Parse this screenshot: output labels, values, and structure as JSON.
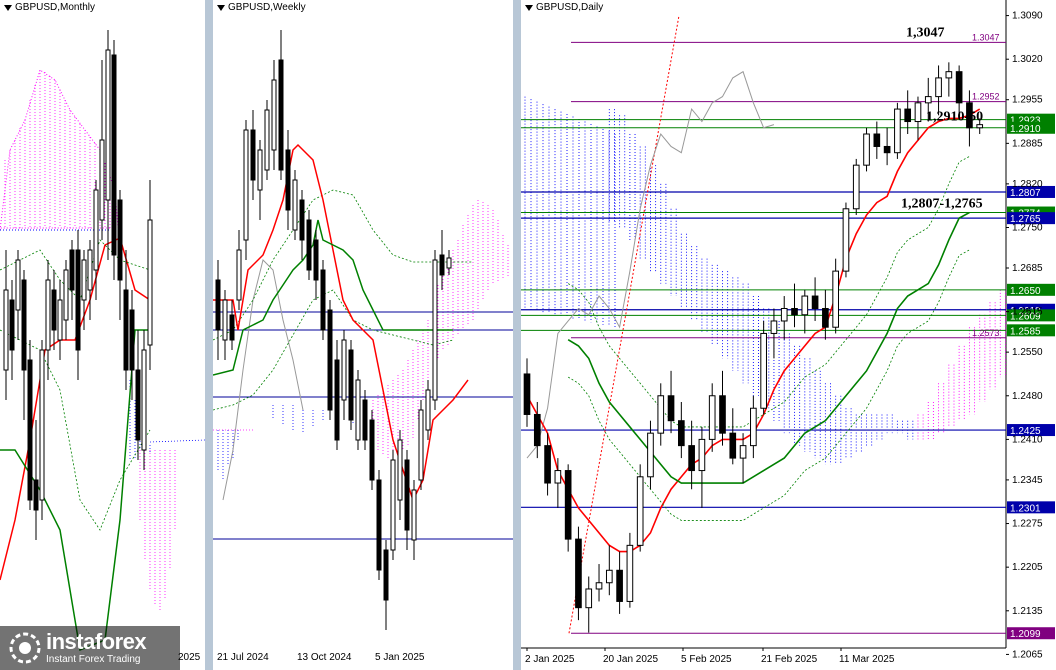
{
  "panels": {
    "monthly": {
      "title": "GBPUSD,Monthly",
      "date_labels": [
        "2025"
      ]
    },
    "weekly": {
      "title": "GBPUSD,Weekly",
      "date_labels": [
        "21 Jul 2024",
        "13 Oct 2024",
        "5 Jan 2025"
      ]
    },
    "daily": {
      "title": "GBPUSD,Daily",
      "date_labels": [
        "2 Jan 2025",
        "20 Jan 2025",
        "5 Feb 2025",
        "21 Feb 2025",
        "11 Mar 2025"
      ]
    }
  },
  "watermark": {
    "name": "instaforex",
    "tagline": "Instant Forex Trading"
  },
  "colors": {
    "up": "#000000",
    "down": "#000000",
    "tenkan": "#ff0000",
    "kijun": "#008000",
    "cloud_bull": "#ff00ff",
    "cloud_bear": "#0000ff",
    "level_blue": "#000099",
    "level_green": "#008000",
    "level_purple": "#800080",
    "tag_green": "#008000",
    "tag_blue": "#0000aa"
  },
  "chart_data": {
    "type": "candlestick",
    "title": "GBPUSD,Daily",
    "price_axis": [
      "1.3090",
      "1.3020",
      "1.2955",
      "1.2885",
      "1.2820",
      "1.2750",
      "1.2685",
      "1.2615",
      "1.2550",
      "1.2480",
      "1.2410",
      "1.2345",
      "1.2275",
      "1.2205",
      "1.2135",
      "1.2065"
    ],
    "ylim": [
      1.204,
      1.3115
    ],
    "x_labels": [
      "2 Jan 2025",
      "20 Jan 2025",
      "5 Feb 2025",
      "21 Feb 2025",
      "11 Mar 2025"
    ],
    "annotations": [
      {
        "text": "1,3047",
        "value": 1.3047
      },
      {
        "text": "1,2910-50",
        "value": 1.293
      },
      {
        "text": "1,2807-1,2765",
        "value": 1.279
      }
    ],
    "levels": [
      {
        "value": 1.3047,
        "label": "1.3047",
        "color": "#800080",
        "tag": false
      },
      {
        "value": 1.2952,
        "label": "1.2952",
        "color": "#800080",
        "tag": false
      },
      {
        "value": 1.2923,
        "label": "1.2923",
        "color": "#008000",
        "tag": true
      },
      {
        "value": 1.291,
        "label": "1.2910",
        "color": "#008000",
        "tag": true
      },
      {
        "value": 1.2807,
        "label": "1.2807",
        "color": "#0000aa",
        "tag": true
      },
      {
        "value": 1.2774,
        "label": "1.2774",
        "color": "#008000",
        "tag": true
      },
      {
        "value": 1.2765,
        "label": "1.2765",
        "color": "#0000aa",
        "tag": true
      },
      {
        "value": 1.265,
        "label": "1.2650",
        "color": "#008000",
        "tag": true
      },
      {
        "value": 1.2618,
        "label": "1.2618",
        "color": "#0000aa",
        "tag": true
      },
      {
        "value": 1.2609,
        "label": "1.2609",
        "color": "#008000",
        "tag": true
      },
      {
        "value": 1.2585,
        "label": "1.2585",
        "color": "#008000",
        "tag": true
      },
      {
        "value": 1.2573,
        "label": "1.2573",
        "color": "#800080",
        "tag": false
      },
      {
        "value": 1.2425,
        "label": "1.2425",
        "color": "#0000aa",
        "tag": true
      },
      {
        "value": 1.2301,
        "label": "1.2301",
        "color": "#0000aa",
        "tag": true
      },
      {
        "value": 1.2099,
        "label": "1.2099",
        "color": "#800080",
        "tag": true
      }
    ],
    "ohlc": [
      [
        1.2515,
        1.254,
        1.243,
        1.245
      ],
      [
        1.245,
        1.247,
        1.238,
        1.24
      ],
      [
        1.24,
        1.242,
        1.232,
        1.234
      ],
      [
        1.234,
        1.238,
        1.23,
        1.236
      ],
      [
        1.236,
        1.237,
        1.223,
        1.225
      ],
      [
        1.225,
        1.227,
        1.212,
        1.214
      ],
      [
        1.214,
        1.219,
        1.21,
        1.217
      ],
      [
        1.217,
        1.221,
        1.215,
        1.218
      ],
      [
        1.218,
        1.224,
        1.216,
        1.22
      ],
      [
        1.22,
        1.223,
        1.213,
        1.215
      ],
      [
        1.215,
        1.226,
        1.214,
        1.224
      ],
      [
        1.224,
        1.237,
        1.223,
        1.235
      ],
      [
        1.235,
        1.244,
        1.233,
        1.242
      ],
      [
        1.242,
        1.25,
        1.24,
        1.248
      ],
      [
        1.248,
        1.252,
        1.242,
        1.244
      ],
      [
        1.244,
        1.247,
        1.238,
        1.24
      ],
      [
        1.24,
        1.244,
        1.233,
        1.236
      ],
      [
        1.236,
        1.243,
        1.23,
        1.241
      ],
      [
        1.241,
        1.25,
        1.239,
        1.248
      ],
      [
        1.248,
        1.252,
        1.24,
        1.242
      ],
      [
        1.242,
        1.246,
        1.237,
        1.238
      ],
      [
        1.238,
        1.242,
        1.234,
        1.24
      ],
      [
        1.24,
        1.248,
        1.238,
        1.246
      ],
      [
        1.246,
        1.26,
        1.245,
        1.258
      ],
      [
        1.258,
        1.262,
        1.254,
        1.26
      ],
      [
        1.26,
        1.264,
        1.257,
        1.262
      ],
      [
        1.262,
        1.266,
        1.259,
        1.261
      ],
      [
        1.261,
        1.265,
        1.258,
        1.264
      ],
      [
        1.264,
        1.267,
        1.26,
        1.262
      ],
      [
        1.262,
        1.265,
        1.257,
        1.259
      ],
      [
        1.259,
        1.27,
        1.258,
        1.268
      ],
      [
        1.268,
        1.279,
        1.267,
        1.278
      ],
      [
        1.278,
        1.286,
        1.277,
        1.285
      ],
      [
        1.285,
        1.291,
        1.284,
        1.29
      ],
      [
        1.29,
        1.292,
        1.286,
        1.288
      ],
      [
        1.288,
        1.291,
        1.285,
        1.287
      ],
      [
        1.287,
        1.295,
        1.286,
        1.294
      ],
      [
        1.294,
        1.297,
        1.29,
        1.292
      ],
      [
        1.292,
        1.296,
        1.289,
        1.295
      ],
      [
        1.295,
        1.299,
        1.292,
        1.296
      ],
      [
        1.296,
        1.301,
        1.293,
        1.299
      ],
      [
        1.299,
        1.3015,
        1.296,
        1.3
      ],
      [
        1.3,
        1.301,
        1.293,
        1.295
      ],
      [
        1.295,
        1.297,
        1.288,
        1.291
      ],
      [
        1.291,
        1.2925,
        1.29,
        1.2915
      ]
    ],
    "tenkan": [
      1.248,
      1.245,
      1.242,
      1.236,
      1.233,
      1.23,
      1.228,
      1.226,
      1.224,
      1.223,
      1.223,
      1.224,
      1.226,
      1.23,
      1.233,
      1.235,
      1.237,
      1.238,
      1.24,
      1.241,
      1.241,
      1.241,
      1.242,
      1.245,
      1.249,
      1.252,
      1.254,
      1.256,
      1.258,
      1.259,
      1.264,
      1.27,
      1.274,
      1.277,
      1.279,
      1.28,
      1.284,
      1.287,
      1.289,
      1.291,
      1.292,
      1.2925,
      1.2925,
      1.293,
      1.294
    ],
    "kijun": [
      1.257,
      1.256,
      1.254,
      1.25,
      1.247,
      1.245,
      1.243,
      1.241,
      1.239,
      1.237,
      1.235,
      1.234,
      1.234,
      1.234,
      1.234,
      1.234,
      1.234,
      1.234,
      1.235,
      1.236,
      1.237,
      1.238,
      1.24,
      1.242,
      1.243,
      1.244,
      1.246,
      1.248,
      1.25,
      1.252,
      1.255,
      1.258,
      1.262,
      1.264,
      1.265,
      1.266,
      1.269,
      1.273,
      1.2765,
      1.2774
    ],
    "cloud_top": [
      1.294,
      1.293,
      1.29,
      1.288,
      1.285,
      1.282,
      1.278,
      1.274,
      1.272,
      1.27,
      1.269,
      1.268,
      1.267,
      1.266,
      1.264,
      1.262,
      1.26,
      1.258,
      1.256,
      1.254,
      1.252,
      1.25,
      1.248,
      1.246,
      1.245,
      1.245,
      1.245,
      1.245,
      1.244,
      1.244,
      1.245,
      1.247,
      1.25,
      1.253,
      1.256,
      1.259,
      1.261,
      1.263,
      1.265,
      1.266
    ],
    "cloud_bottom": [
      1.276,
      1.275,
      1.273,
      1.27,
      1.268,
      1.266,
      1.264,
      1.262,
      1.26,
      1.258,
      1.256,
      1.254,
      1.252,
      1.25,
      1.248,
      1.246,
      1.244,
      1.242,
      1.24,
      1.239,
      1.238,
      1.237,
      1.237,
      1.238,
      1.239,
      1.24,
      1.241,
      1.242,
      1.242,
      1.241,
      1.241,
      1.241,
      1.242,
      1.243,
      1.244,
      1.245,
      1.247,
      1.249,
      1.251,
      1.253
    ]
  }
}
